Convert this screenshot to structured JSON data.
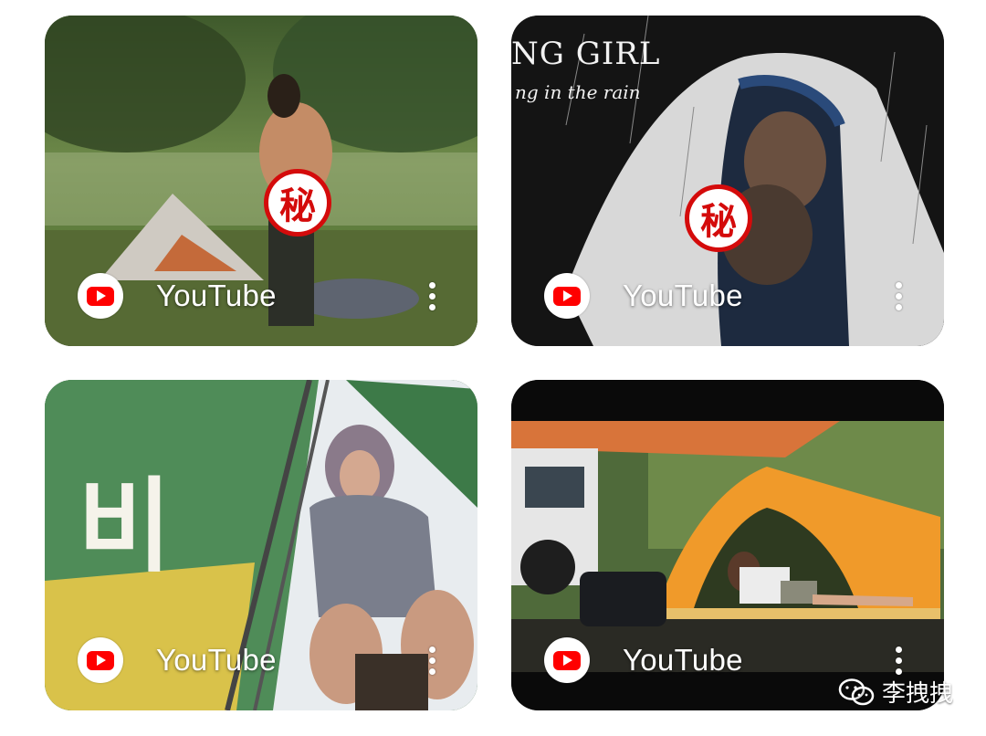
{
  "cards": [
    {
      "source": "YouTube",
      "icon": "youtube-icon",
      "censor": "秘"
    },
    {
      "source": "YouTube",
      "icon": "youtube-icon",
      "overlay_title": "NG GIRL",
      "overlay_subtitle": "ng in the rain",
      "censor": "秘"
    },
    {
      "source": "YouTube",
      "icon": "youtube-icon",
      "overlay_hangul": "비"
    },
    {
      "source": "YouTube",
      "icon": "youtube-icon"
    }
  ],
  "watermark": {
    "icon": "wechat-icon",
    "text": "李拽拽"
  },
  "colors": {
    "youtube_red": "#ff0000",
    "censor_red": "#d40b0b"
  }
}
